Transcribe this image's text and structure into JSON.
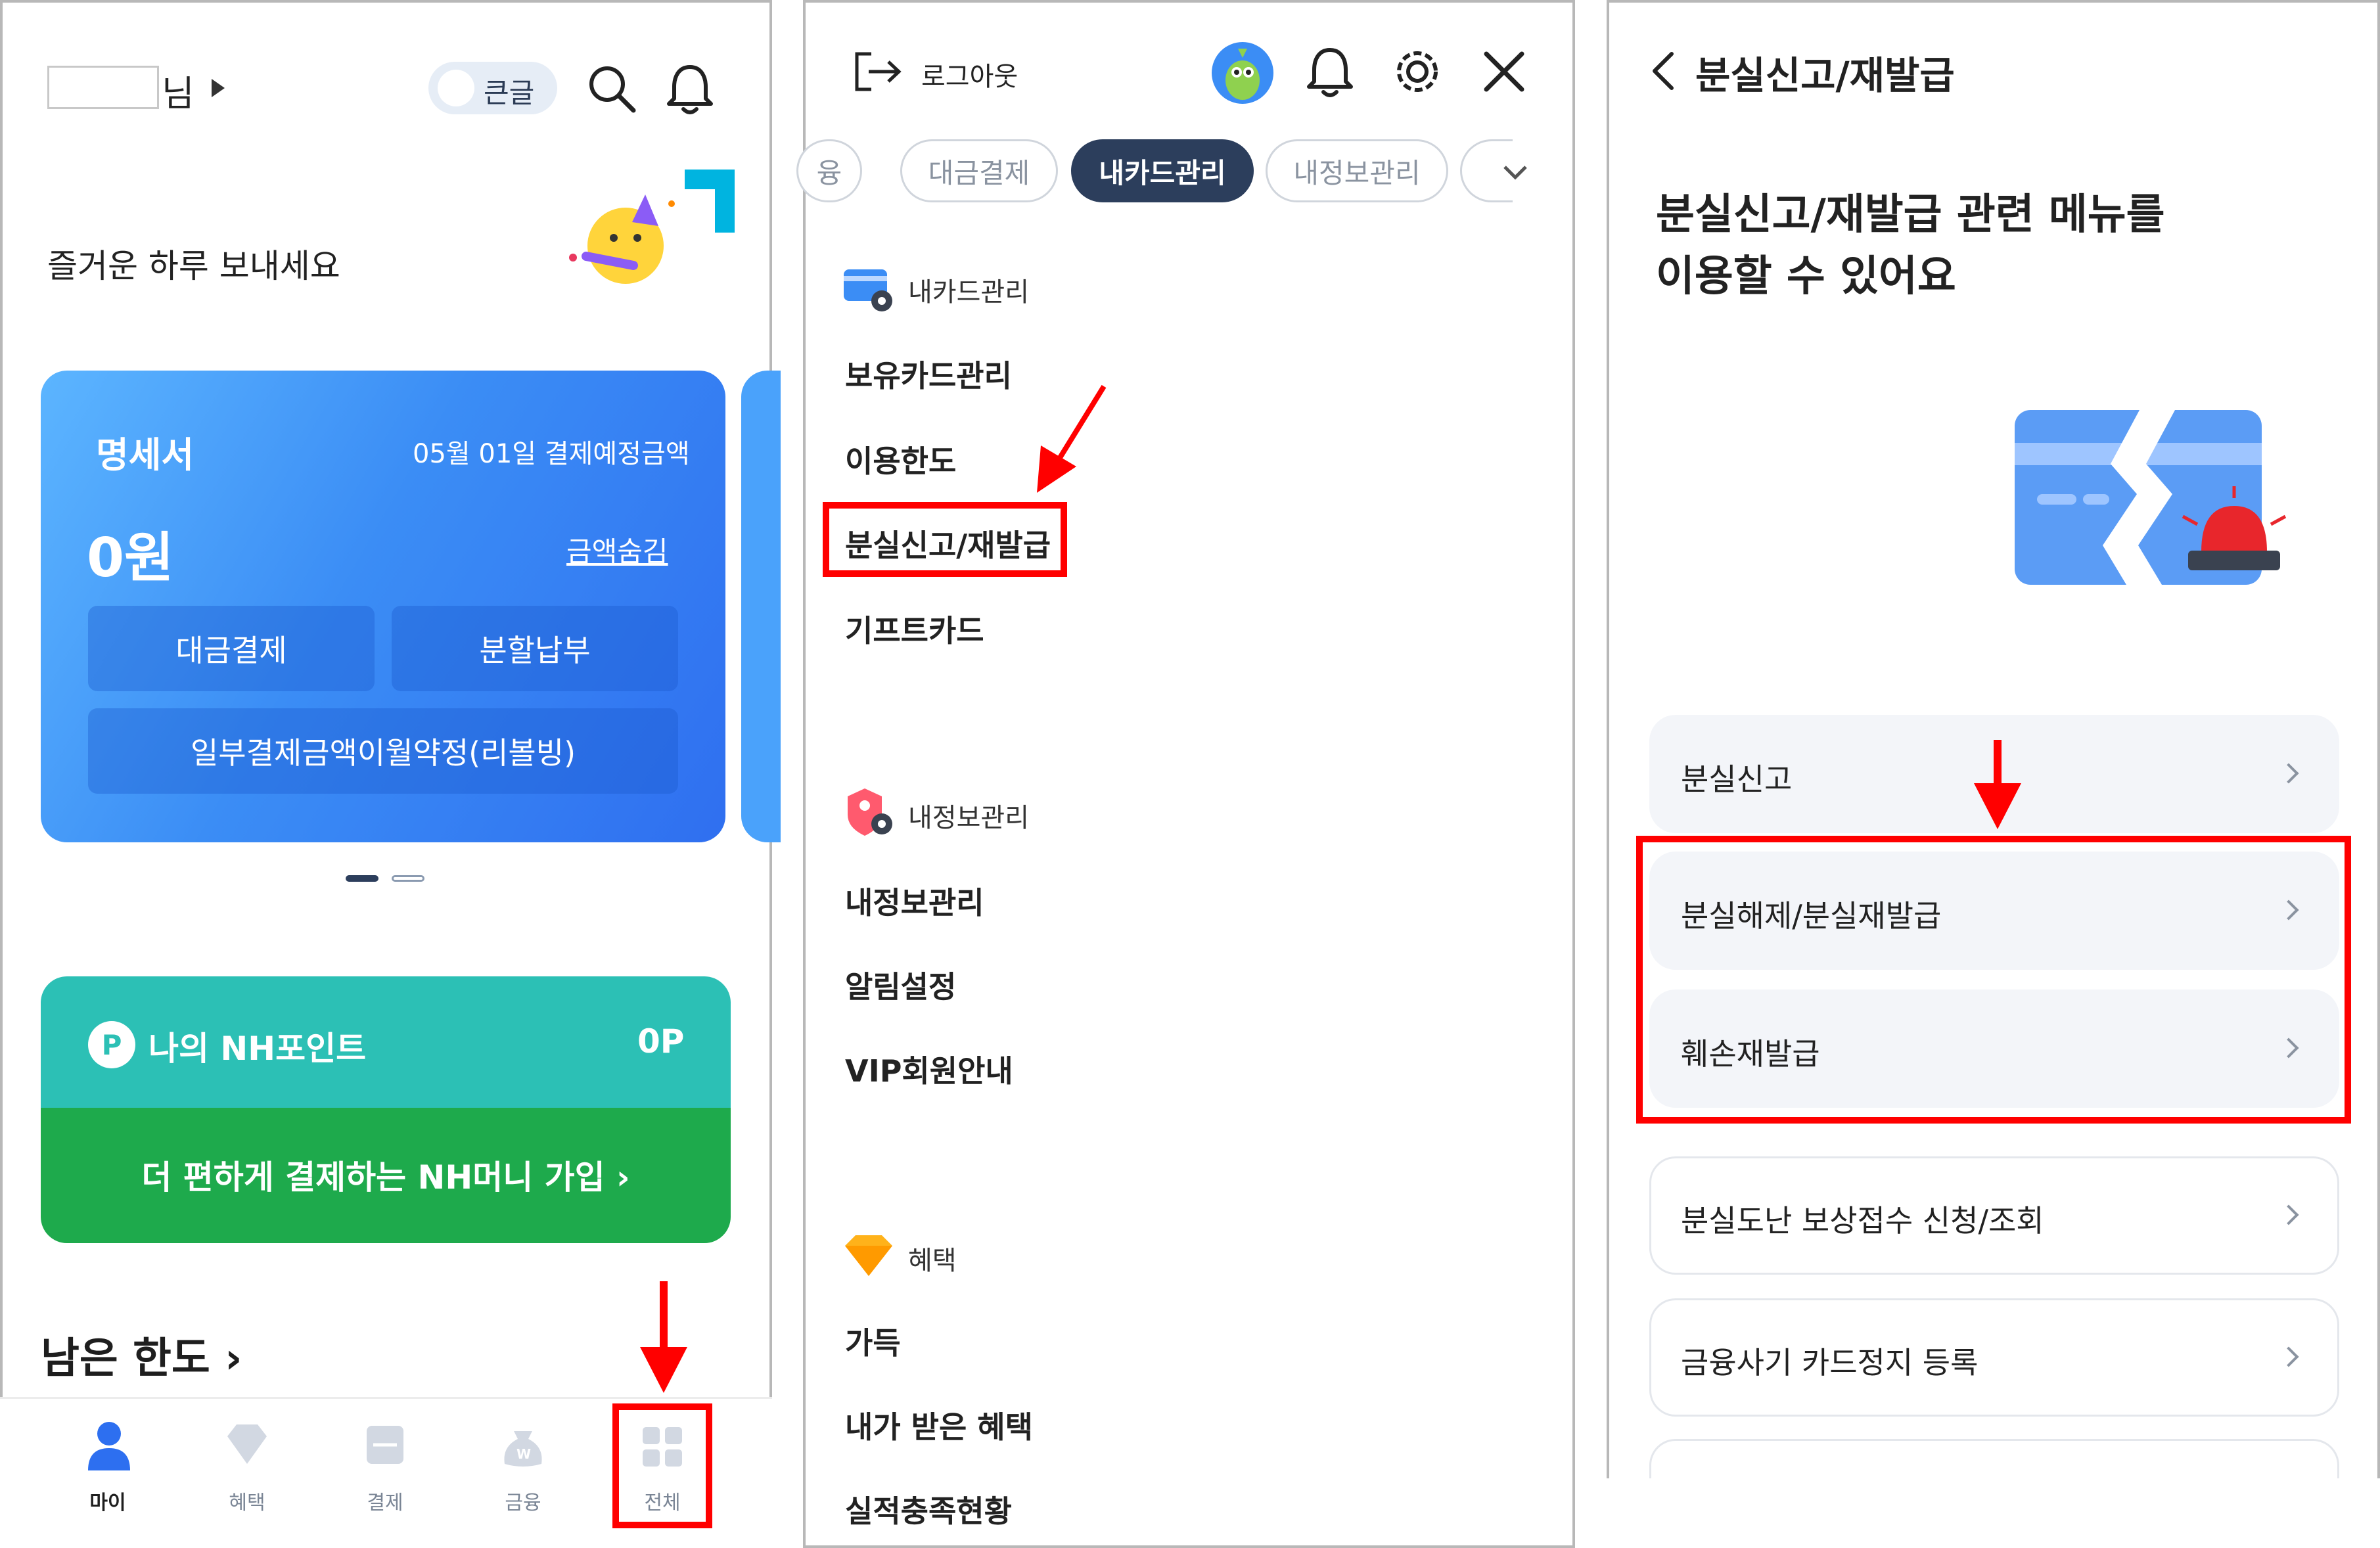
{
  "panel_home": {
    "suffix": "님",
    "big_text_toggle": "큰글",
    "greeting": "즐거운 하루 보내세요",
    "statement": {
      "title": "명세서",
      "due": "05월 01일 결제예정금액",
      "amount": "0원",
      "hide": "금액숨김",
      "buttons": [
        "대금결제",
        "분할납부",
        "일부결제금액이월약정(리볼빙)"
      ]
    },
    "points": {
      "badge": "P",
      "title": "나의 NH포인트",
      "value": "0P",
      "join": "더 편하게 결제하는 NH머니 가입 ›"
    },
    "limit": "남은 한도 ›",
    "nav": [
      "마이",
      "혜택",
      "결제",
      "금융",
      "전체"
    ]
  },
  "panel_menu": {
    "logout": "로그아웃",
    "chips": [
      "융",
      "대금결제",
      "내카드관리",
      "내정보관리",
      ""
    ],
    "sections": [
      {
        "label": "내카드관리",
        "items": [
          "보유카드관리",
          "이용한도",
          "분실신고/재발급",
          "기프트카드"
        ]
      },
      {
        "label": "내정보관리",
        "items": [
          "내정보관리",
          "알림설정",
          "VIP회원안내"
        ]
      },
      {
        "label": "혜택",
        "items": [
          "가득",
          "내가 받은 혜택",
          "실적충족현황"
        ]
      }
    ]
  },
  "panel_lost": {
    "title": "분실신고/재발급",
    "heading_line1": "분실신고/재발급 관련 메뉴를",
    "heading_line2": "이용할 수 있어요",
    "rows": [
      "분실신고",
      "분실해제/분실재발급",
      "훼손재발급",
      "분실도난 보상접수 신청/조회",
      "금융사기 카드정지 등록"
    ]
  },
  "colors": {
    "card_blue": "#3b8df5",
    "points_teal": "#2cc0b5",
    "points_green": "#1eaa4c",
    "chip_active": "#2c3e5c",
    "annotation_red": "#ff0000"
  }
}
